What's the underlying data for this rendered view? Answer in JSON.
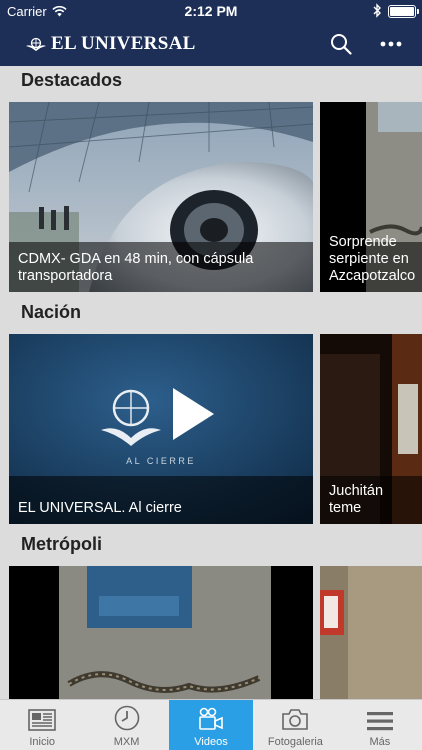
{
  "status_bar": {
    "carrier": "Carrier",
    "time": "2:12 PM"
  },
  "header": {
    "brand": "EL UNIVERSAL"
  },
  "sections": [
    {
      "title": "Destacados",
      "cards": [
        {
          "caption": "CDMX- GDA en 48 min, con cápsula transportadora"
        },
        {
          "caption": "Sorprende serpiente en Azcapotzalco"
        }
      ]
    },
    {
      "title": "Nación",
      "cards": [
        {
          "caption": "EL UNIVERSAL. Al cierre",
          "overlay_text": "AL CIERRE"
        },
        {
          "caption": "Juchitán teme"
        }
      ]
    },
    {
      "title": "Metrópoli",
      "cards": [
        {},
        {}
      ]
    }
  ],
  "tabs": [
    {
      "label": "Inicio",
      "icon": "newspaper-icon"
    },
    {
      "label": "MXM",
      "icon": "clock-icon"
    },
    {
      "label": "Videos",
      "icon": "video-camera-icon",
      "active": true
    },
    {
      "label": "Fotogaleria",
      "icon": "camera-icon"
    },
    {
      "label": "Más",
      "icon": "menu-icon"
    }
  ],
  "colors": {
    "header_bg": "#1d2f57",
    "tab_active": "#2a9fe6",
    "content_bg": "#dcdcdc"
  }
}
